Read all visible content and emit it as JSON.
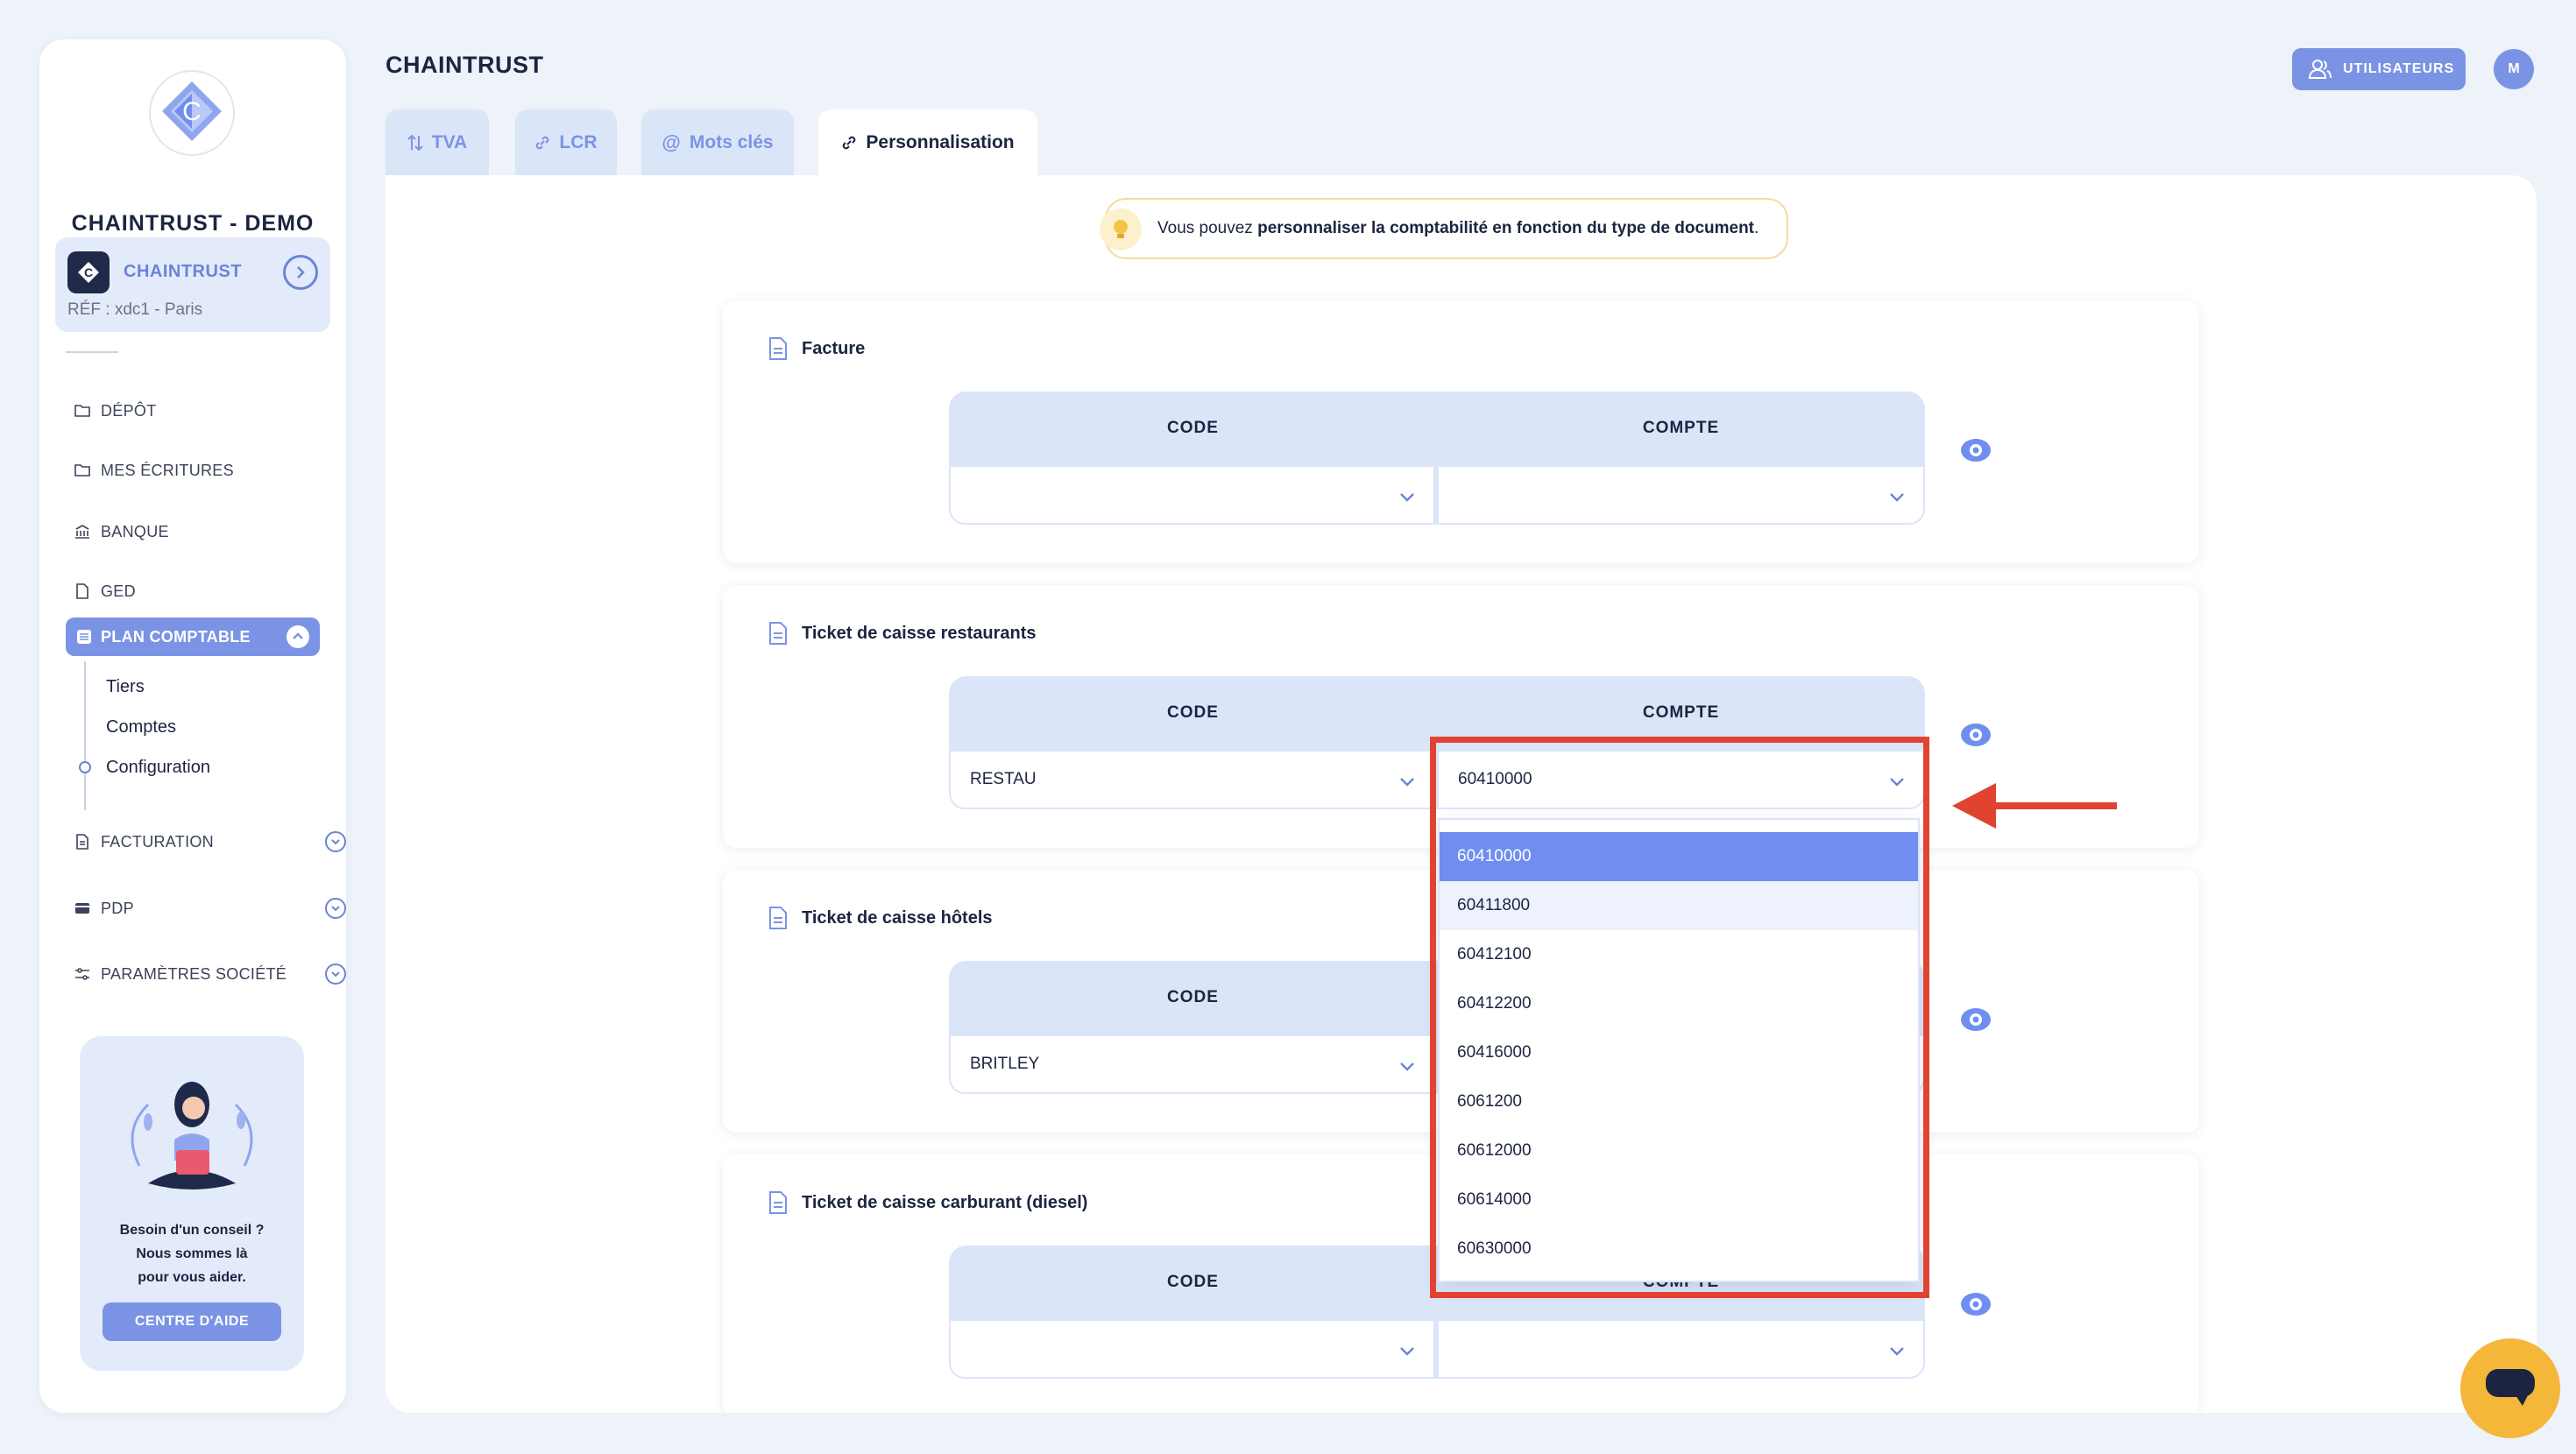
{
  "sidebar": {
    "company_title": "CHAINTRUST - DEMO",
    "company_card": {
      "name": "CHAINTRUST",
      "ref": "RÉF : xdc1 - Paris"
    },
    "nav": {
      "depot": "DÉPÔT",
      "ecritures": "MES ÉCRITURES",
      "banque": "BANQUE",
      "ged": "GED",
      "plan_comptable": "PLAN COMPTABLE",
      "facturation": "FACTURATION",
      "pdp": "PDP",
      "parametres": "PARAMÈTRES SOCIÉTÉ"
    },
    "subnav": {
      "tiers": "Tiers",
      "comptes": "Comptes",
      "configuration": "Configuration"
    },
    "help": {
      "line1": "Besoin d'un conseil ?",
      "line2": "Nous sommes là",
      "line3": "pour vous aider.",
      "button": "CENTRE D'AIDE"
    }
  },
  "header": {
    "title": "CHAINTRUST",
    "users_button": "UTILISATEURS",
    "avatar_initial": "M"
  },
  "tabs": {
    "tva": "TVA",
    "lcr": "LCR",
    "mots_cles": "Mots clés",
    "personnalisation": "Personnalisation"
  },
  "notice": {
    "prefix": "Vous pouvez ",
    "bold": "personnaliser la comptabilité en fonction du type de document",
    "suffix": "."
  },
  "table_headers": {
    "code": "CODE",
    "compte": "COMPTE"
  },
  "sections": {
    "facture": {
      "title": "Facture",
      "code": "",
      "compte": ""
    },
    "restau": {
      "title": "Ticket de caisse restaurants",
      "code": "RESTAU",
      "compte": "60410000"
    },
    "hotels": {
      "title": "Ticket de caisse hôtels",
      "code": "BRITLEY",
      "compte": ""
    },
    "carburant": {
      "title": "Ticket de caisse carburant (diesel)",
      "code": "",
      "compte": ""
    }
  },
  "dropdown": {
    "options": [
      "60410000",
      "60411800",
      "60412100",
      "60412200",
      "60416000",
      "6061200",
      "60612000",
      "60614000",
      "60630000"
    ],
    "selected": "60410000"
  },
  "colors": {
    "accent": "#7a93e4",
    "selected_option": "#6f8ef0",
    "annotation_red": "#e04431",
    "chat": "#f4b73a"
  }
}
